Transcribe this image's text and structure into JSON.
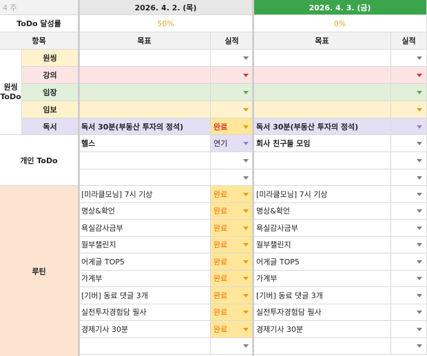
{
  "header": {
    "week": "4 주",
    "day1": "2026. 4. 2. (목)",
    "day2": "2026. 4. 3. (금)",
    "rate_label": "ToDo 달성률",
    "rate1": "50%",
    "rate2": "0%",
    "item_label": "항목",
    "goal_label": "목표",
    "result_label": "실적"
  },
  "wonsing": {
    "group_label": "원씽\nToDo",
    "items": [
      "원씽",
      "강의",
      "임장",
      "임보",
      "독서"
    ],
    "reading_goal1": "독서 30분(부동산 투자의 정석)",
    "reading_result1": "완료",
    "reading_goal2": "독서 30분(부동산 투자의 정석)"
  },
  "personal": {
    "group_label": "개인 ToDo",
    "goal1": "헬스",
    "result1": "연기",
    "goal2": "회사 친구들 모임"
  },
  "routine": {
    "group_label": "루틴",
    "items": [
      "[미라클모닝] 7시 기상",
      "명상&확언",
      "욕실감사금부",
      "월부챌린지",
      "어게글 TOP5",
      "가계부",
      "[기버] 동료 댓글 3개",
      "실전투자경험담 필사",
      "경제기사 30분"
    ],
    "done_label": "완료"
  },
  "colors": {
    "green_header": "#3aa54a",
    "wonsing": "#fff2cc",
    "lecture": "#fde4e4",
    "imjang": "#e2efda",
    "reading": "#e4dff5",
    "routine": "#fde4d0",
    "done_bg": "#ffe699"
  }
}
